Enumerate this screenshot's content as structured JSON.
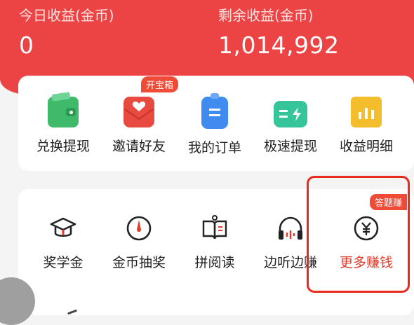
{
  "summary": {
    "today_label": "今日收益(金币)",
    "today_value": "0",
    "remaining_label": "剩余收益(金币)",
    "remaining_value": "1,014,992"
  },
  "shortcuts": {
    "badge": "开宝箱",
    "items": [
      {
        "label": "兑换提现",
        "icon": "wallet-icon"
      },
      {
        "label": "邀请好友",
        "icon": "invite-envelope-icon"
      },
      {
        "label": "我的订单",
        "icon": "order-icon"
      },
      {
        "label": "极速提现",
        "icon": "fast-cash-icon"
      },
      {
        "label": "收益明细",
        "icon": "earnings-detail-icon"
      }
    ]
  },
  "earn": {
    "badge": "答题赚",
    "items": [
      {
        "label": "奖学金",
        "icon": "graduation-cap-icon"
      },
      {
        "label": "金币抽奖",
        "icon": "spinner-dial-icon"
      },
      {
        "label": "拼阅读",
        "icon": "book-icon"
      },
      {
        "label": "边听边赚",
        "icon": "headphones-icon"
      },
      {
        "label": "更多赚钱",
        "icon": "yuan-coin-icon"
      }
    ]
  },
  "colors": {
    "brand_red": "#ec4444",
    "highlight_red": "#e72a1d",
    "wallet_green": "#3fb96a",
    "invite_red": "#e94a3f",
    "order_blue": "#3f8bf0",
    "fast_teal": "#36c59a",
    "detail_yellow": "#f4bd2c"
  }
}
